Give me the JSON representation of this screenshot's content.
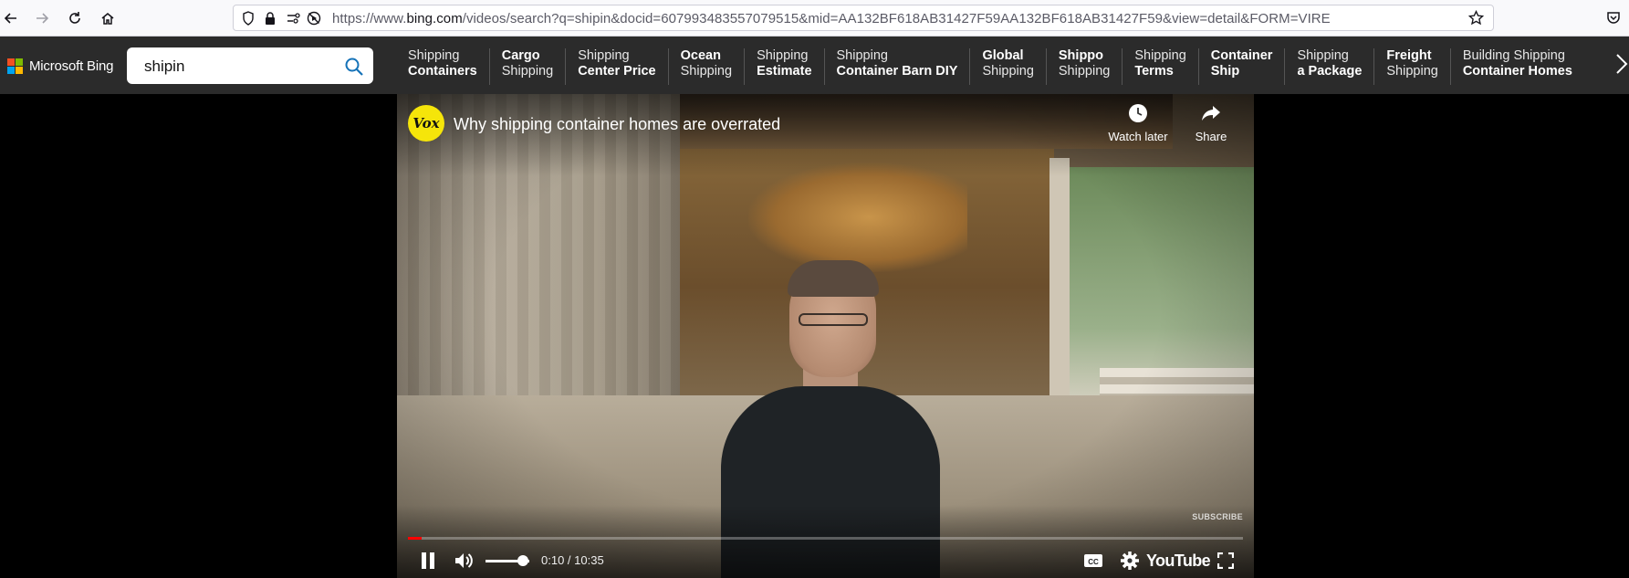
{
  "browser": {
    "url_prefix": "https://www.",
    "url_domain": "bing.com",
    "url_rest": "/videos/search?q=shipin&docid=607993483557079515&mid=AA132BF618AB31427F59AA132BF618AB31427F59&view=detail&FORM=VIRE"
  },
  "bing": {
    "logo_text": "Microsoft Bing",
    "search_value": "shipin",
    "related": [
      {
        "line1": "Shipping",
        "line2": "Containers",
        "bold": 2
      },
      {
        "line1": "Cargo",
        "line2": "Shipping",
        "bold": 1
      },
      {
        "line1": "Shipping",
        "line2": "Center Price",
        "bold": 2
      },
      {
        "line1": "Ocean",
        "line2": "Shipping",
        "bold": 1
      },
      {
        "line1": "Shipping",
        "line2": "Estimate",
        "bold": 2
      },
      {
        "line1": "Shipping",
        "line2": "Container Barn DIY",
        "bold": 2
      },
      {
        "line1": "Global",
        "line2": "Shipping",
        "bold": 1
      },
      {
        "line1": "Shippo",
        "line2": "Shipping",
        "bold": 1
      },
      {
        "line1": "Shipping",
        "line2": "Terms",
        "bold": 2
      },
      {
        "line1": "Container",
        "line2": "Ship",
        "bold": 3
      },
      {
        "line1": "Shipping",
        "line2": "a Package",
        "bold": 2
      },
      {
        "line1": "Freight",
        "line2": "Shipping",
        "bold": 1
      },
      {
        "line1": "Building Shipping",
        "line2": "Container Homes",
        "bold": 2
      }
    ]
  },
  "video": {
    "channel_avatar_text": "Vox",
    "title": "Why shipping container homes are overrated",
    "watch_later_label": "Watch later",
    "share_label": "Share",
    "subscribe_label": "SUBSCRIBE",
    "time_display": "0:10 / 10:35",
    "progress_fraction": 0.016,
    "volume_fraction": 0.85,
    "youtube_label": "YouTube"
  },
  "colors": {
    "bing_header": "#2b2b2b",
    "ms_red": "#f25022",
    "ms_green": "#7fba00",
    "ms_blue": "#00a4ef",
    "ms_yellow": "#ffb900",
    "progress_red": "#ff0000",
    "vox_yellow": "#f5e50a"
  }
}
